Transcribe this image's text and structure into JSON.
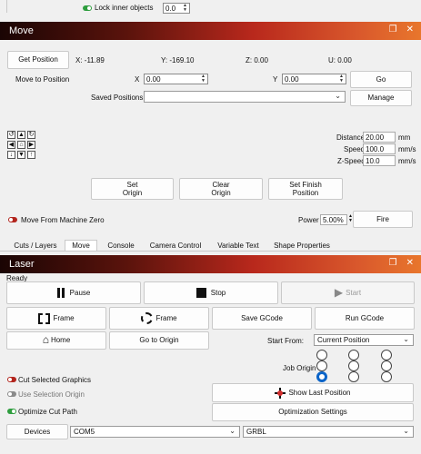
{
  "top": {
    "lock_label": "Lock inner objects",
    "lock_value": "0.0"
  },
  "move": {
    "title": "Move",
    "get_position": "Get Position",
    "x_readout": "X: -11.89",
    "y_readout": "Y: -169.10",
    "z_readout": "Z: 0.00",
    "u_readout": "U: 0.00",
    "move_to_label": "Move to Position",
    "x_label": "X",
    "x_value": "0.00",
    "y_label": "Y",
    "y_value": "0.00",
    "go": "Go",
    "saved_label": "Saved Positions:",
    "saved_value": "",
    "manage": "Manage",
    "distance_label": "Distance",
    "distance_value": "20.00",
    "distance_unit": "mm",
    "speed_label": "Speed",
    "speed_value": "100.0",
    "speed_unit": "mm/s",
    "zspeed_label": "Z-Speed",
    "zspeed_value": "10.0",
    "zspeed_unit": "mm/s",
    "set_origin": "Set\nOrigin",
    "clear_origin": "Clear\nOrigin",
    "set_finish": "Set Finish\nPosition",
    "move_from_zero": "Move From Machine Zero",
    "power_label": "Power",
    "power_value": "5.00%",
    "fire": "Fire"
  },
  "tabs": [
    "Cuts / Layers",
    "Move",
    "Console",
    "Camera Control",
    "Variable Text",
    "Shape Properties"
  ],
  "laser": {
    "title": "Laser",
    "status": "Ready",
    "pause": "Pause",
    "stop": "Stop",
    "start": "Start",
    "frame1": "Frame",
    "frame2": "Frame",
    "save_gcode": "Save GCode",
    "run_gcode": "Run GCode",
    "home": "Home",
    "go_to_origin": "Go to Origin",
    "start_from_label": "Start From:",
    "start_from_value": "Current Position",
    "job_origin_label": "Job Origin",
    "cut_selected": "Cut Selected Graphics",
    "use_selection_origin": "Use Selection Origin",
    "show_last_position": "Show Last Position",
    "optimize_cut_path": "Optimize Cut Path",
    "optimization_settings": "Optimization Settings",
    "devices": "Devices",
    "port_value": "COM5",
    "controller_value": "GRBL"
  },
  "colors": {
    "toggle_on": "#2e9d3e",
    "toggle_off_red": "#b3261e",
    "radio_selected": "#0b64c8"
  }
}
